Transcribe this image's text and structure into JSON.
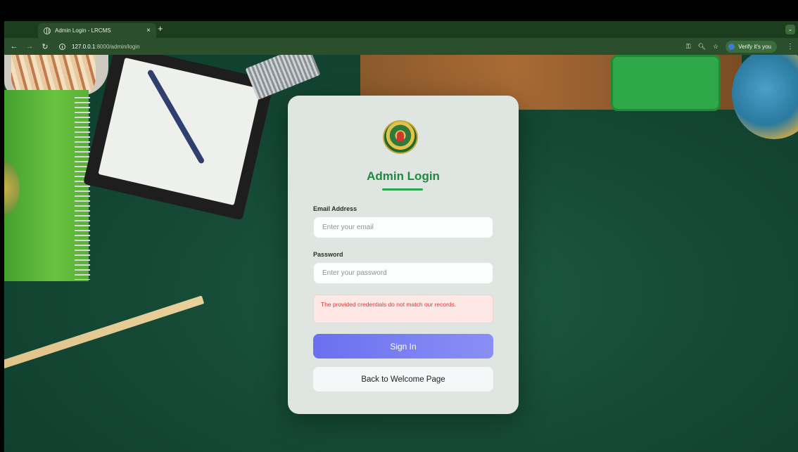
{
  "browser": {
    "tab_title": "Admin Login - LRCMS",
    "tab_close": "×",
    "new_tab": "+",
    "url_host": "127.0.0.1",
    "url_path": ":8000/admin/login",
    "verify_label": "Verify it's you",
    "icons": [
      "back-icon",
      "forward-icon",
      "reload-icon",
      "site-info-icon",
      "key-icon",
      "zoom-icon",
      "bookmark-star-icon",
      "menu-icon"
    ]
  },
  "login": {
    "title": "Admin Login",
    "email": {
      "label": "Email Address",
      "placeholder": "Enter your email",
      "value": ""
    },
    "password": {
      "label": "Password",
      "placeholder": "Enter your password",
      "value": ""
    },
    "error": "The provided credentials do not match our records.",
    "sign_in_label": "Sign In",
    "back_label": "Back to Welcome Page"
  },
  "colors": {
    "accent_green": "#1f8a3d",
    "button_gradient_start": "#6a70f0",
    "button_gradient_end": "#8a8ff5",
    "error_text": "#d8383a",
    "error_bg": "#fde8e6"
  }
}
